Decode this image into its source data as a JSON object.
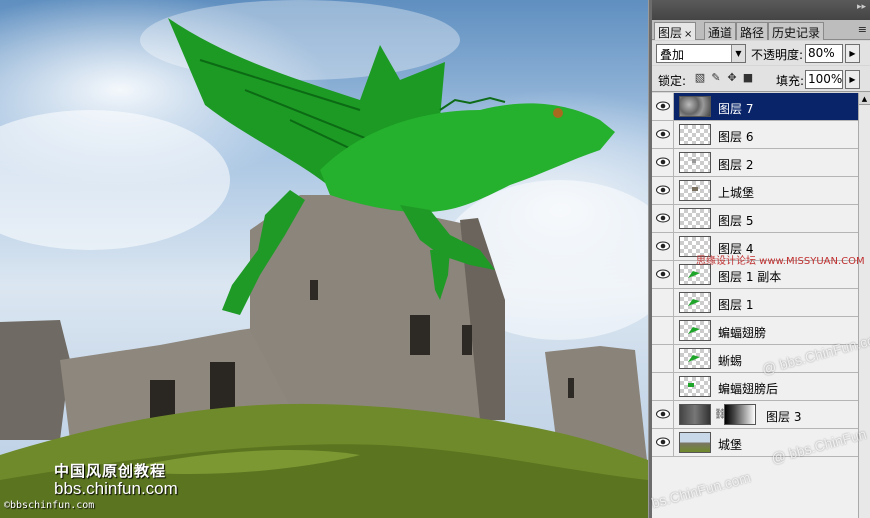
{
  "watermarks": {
    "site_cn": "中国风原创教程",
    "site_url": "bbs.chinfun.com",
    "small": "©bbschinfun.com",
    "panel_1": "@ bbs.ChinFun.com",
    "panel_2": "bs.ChinFun.com",
    "panel_3": "@ bbs.ChinFun",
    "missyuan": "思缘设计论坛 www.MISSYUAN.COM"
  },
  "panel": {
    "tabs": [
      {
        "label": "图层",
        "active": true
      },
      {
        "label": "通道",
        "active": false
      },
      {
        "label": "路径",
        "active": false
      },
      {
        "label": "历史记录",
        "active": false
      }
    ],
    "close_glyph": "×",
    "menu_glyph": "≡",
    "collapse_glyph": "▸▸",
    "blend_mode": "叠加",
    "opacity_label": "不透明度:",
    "opacity_value": "80%",
    "lock_label": "锁定:",
    "fill_label": "填充:",
    "fill_value": "100%",
    "layers": [
      {
        "name": "图层 7",
        "visible": true,
        "selected": true,
        "thumb": "clouds"
      },
      {
        "name": "图层 6",
        "visible": true,
        "selected": false,
        "thumb": "empty"
      },
      {
        "name": "图层 2",
        "visible": true,
        "selected": false,
        "thumb": "speck"
      },
      {
        "name": "上城堡",
        "visible": true,
        "selected": false,
        "thumb": "castle-top"
      },
      {
        "name": "图层 5",
        "visible": true,
        "selected": false,
        "thumb": "empty"
      },
      {
        "name": "图层 4",
        "visible": true,
        "selected": false,
        "thumb": "empty"
      },
      {
        "name": "图层 1 副本",
        "visible": true,
        "selected": false,
        "thumb": "green"
      },
      {
        "name": "图层 1",
        "visible": false,
        "selected": false,
        "thumb": "green"
      },
      {
        "name": "蝙蝠翅膀",
        "visible": false,
        "selected": false,
        "thumb": "green"
      },
      {
        "name": "蜥蜴",
        "visible": false,
        "selected": false,
        "thumb": "green"
      },
      {
        "name": "蝙蝠翅膀后",
        "visible": false,
        "selected": false,
        "thumb": "green-small"
      },
      {
        "name": "图层 3",
        "visible": true,
        "selected": false,
        "thumb": "dark",
        "mask": true
      },
      {
        "name": "城堡",
        "visible": true,
        "selected": false,
        "thumb": "castle"
      }
    ]
  },
  "colors": {
    "selection": "#0a246a",
    "dragon_green": "#1fa52a",
    "stone": "#8a837a",
    "grass": "#6f8a2a"
  }
}
